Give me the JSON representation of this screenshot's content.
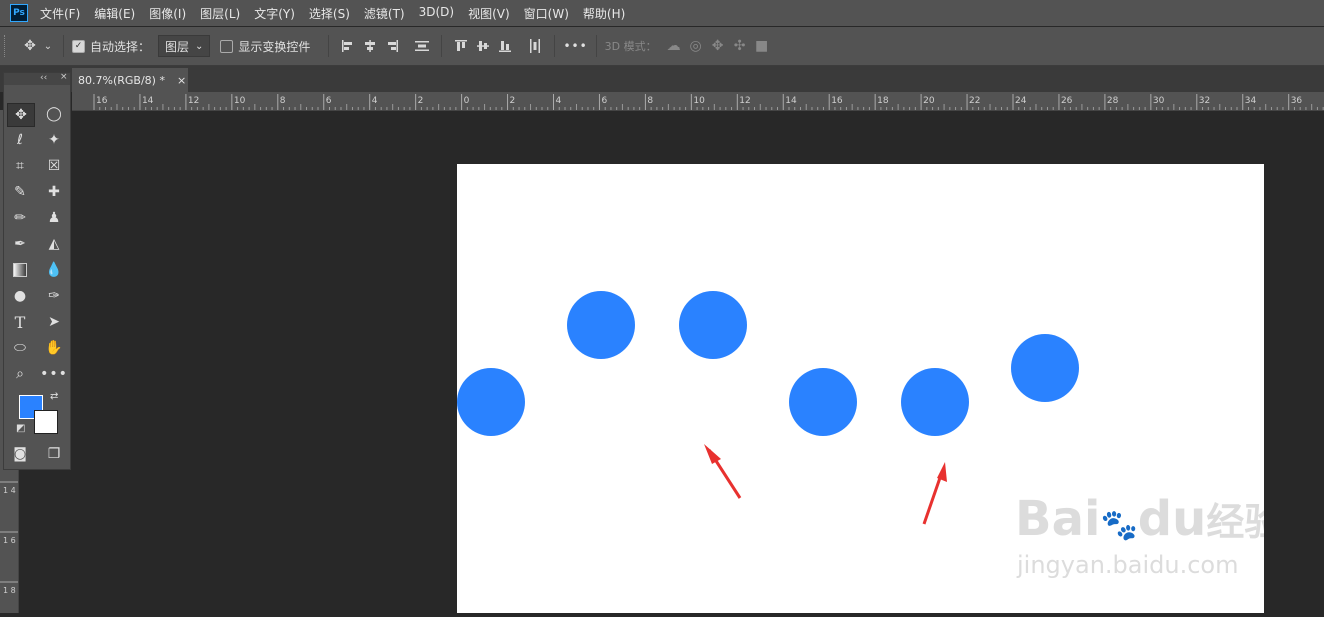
{
  "app": {
    "logo": "Ps"
  },
  "menu": [
    {
      "id": "file",
      "label": "文件(F)"
    },
    {
      "id": "edit",
      "label": "编辑(E)"
    },
    {
      "id": "image",
      "label": "图像(I)"
    },
    {
      "id": "layer",
      "label": "图层(L)"
    },
    {
      "id": "type",
      "label": "文字(Y)"
    },
    {
      "id": "select",
      "label": "选择(S)"
    },
    {
      "id": "filter",
      "label": "滤镜(T)"
    },
    {
      "id": "3d",
      "label": "3D(D)"
    },
    {
      "id": "view",
      "label": "视图(V)"
    },
    {
      "id": "window",
      "label": "窗口(W)"
    },
    {
      "id": "help",
      "label": "帮助(H)"
    }
  ],
  "options": {
    "auto_select_label": "自动选择：",
    "auto_select_checked": true,
    "auto_select_target": "图层",
    "show_transform_label": "显示变换控件",
    "show_transform_checked": false,
    "more_label": "•••",
    "mode_3d_label": "3D 模式："
  },
  "document_tab": {
    "title": "80.7%(RGB/8) *",
    "close": "×"
  },
  "toolbar": {
    "collapse": "‹‹",
    "close": "×"
  },
  "ruler_top_ticks": [
    "16",
    "14",
    "12",
    "10",
    "8",
    "6",
    "4",
    "2",
    "0",
    "2",
    "4",
    "6",
    "8",
    "10",
    "12",
    "14",
    "16",
    "18",
    "20",
    "22",
    "24",
    "26",
    "28",
    "30",
    "32",
    "34",
    "36"
  ],
  "ruler_left_ticks": [
    "1 4",
    "1 6",
    "1 8"
  ],
  "colors": {
    "foreground": "#2a82ff",
    "background": "#ffffff",
    "circle": "#2a82ff",
    "arrow": "#e8312f"
  },
  "watermark": {
    "line1": "Bai",
    "paw": "du",
    "line1b": "经验",
    "line2": "jingyan.baidu.com"
  }
}
